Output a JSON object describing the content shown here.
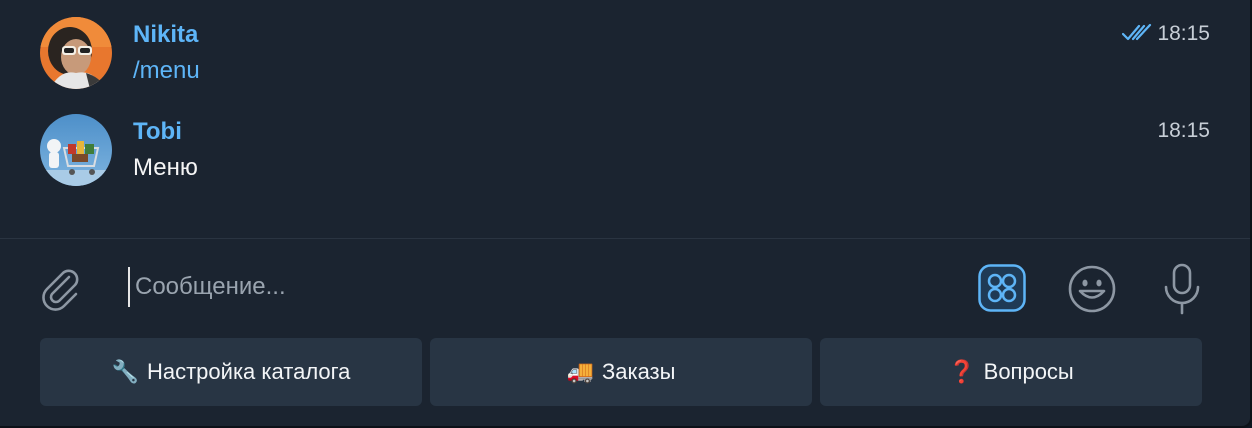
{
  "messages": [
    {
      "sender": "Nikita",
      "text": "/menu",
      "time": "18:15",
      "status": "read",
      "avatar": "nikita-avatar"
    },
    {
      "sender": "Tobi",
      "text": "Меню",
      "time": "18:15",
      "avatar": "tobi-avatar"
    }
  ],
  "composer": {
    "placeholder": "Сообщение...",
    "icons": [
      "paperclip-icon",
      "bot-commands-icon",
      "emoji-icon",
      "microphone-icon"
    ]
  },
  "keyboard": {
    "buttons": [
      {
        "emoji": "🔧",
        "label": "Настройка каталога"
      },
      {
        "emoji": "🚚",
        "label": "Заказы"
      },
      {
        "emoji": "❓",
        "label": "Вопросы"
      }
    ]
  },
  "colors": {
    "background": "#1b2430",
    "accent": "#5eb5f7",
    "button": "#283544"
  }
}
